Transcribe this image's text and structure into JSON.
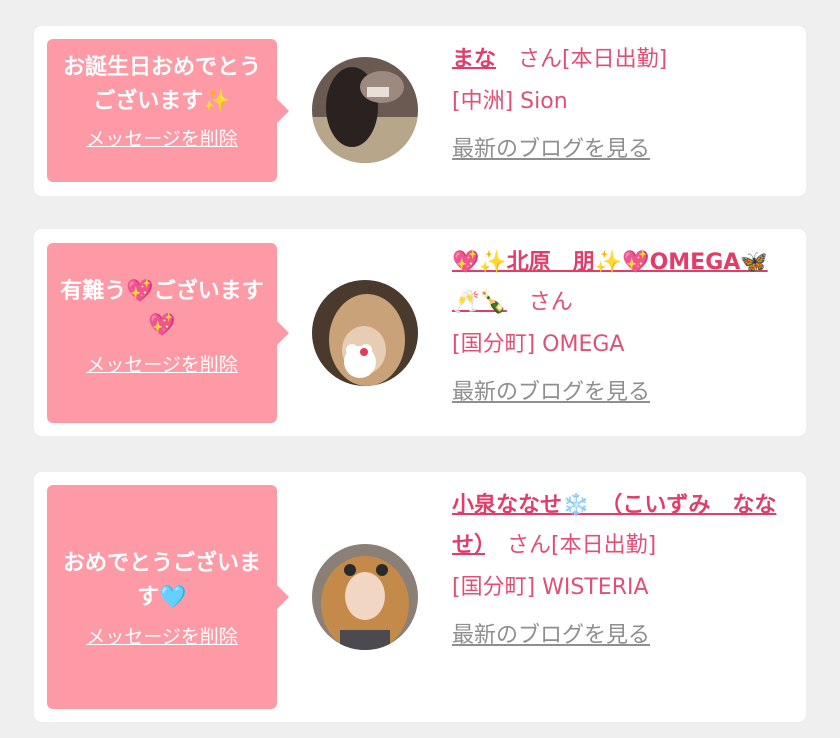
{
  "cards": [
    {
      "message": "お誕生日おめでとうございます✨",
      "delete_label": "メッセージを削除",
      "name": "まな",
      "suffix": "　さん[本日出勤]",
      "shop": "[中洲] Sion",
      "blog_label": "最新のブログを見る"
    },
    {
      "message": "有難う💖ございます💖",
      "delete_label": "メッセージを削除",
      "name": "💖✨北原　朋✨💖OMEGA🦋🥂🍾",
      "suffix": "　さん",
      "shop": "[国分町] OMEGA",
      "blog_label": "最新のブログを見る"
    },
    {
      "message": "おめでとうございます🩵",
      "delete_label": "メッセージを削除",
      "name": "小泉ななせ❄️　（こいずみ　ななせ）",
      "suffix": "　さん[本日出勤]",
      "shop": "[国分町] WISTERIA",
      "blog_label": "最新のブログを見る"
    }
  ],
  "colors": {
    "bubble": "#fd9aa6",
    "name": "#e03d6b",
    "blog": "#8f8f8f",
    "background": "#efefef"
  }
}
